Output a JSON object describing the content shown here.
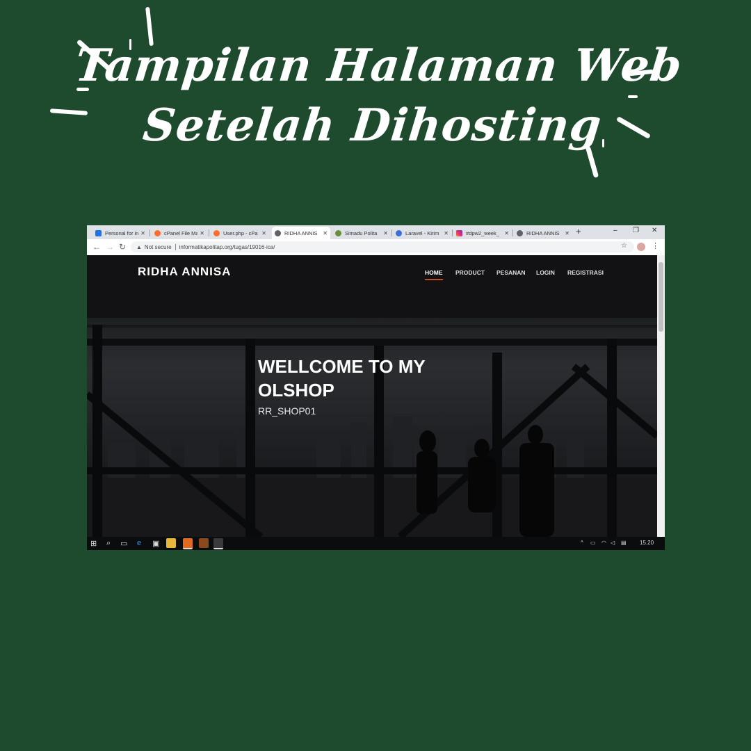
{
  "poster": {
    "title_line1": "Tampilan Halaman Web",
    "title_line2": "Setelah Dihosting"
  },
  "colors": {
    "background": "#1e4a2e",
    "accent_underline": "#c0502b"
  },
  "browser": {
    "tabs": [
      {
        "label": "Personal for in",
        "favicon": "blue-app-icon",
        "active": false
      },
      {
        "label": "cPanel File Ma",
        "favicon": "cpanel-icon",
        "active": false
      },
      {
        "label": "User.php - cPa",
        "favicon": "cpanel-icon",
        "active": false
      },
      {
        "label": "RIDHA ANNIS",
        "favicon": "globe-icon",
        "active": true
      },
      {
        "label": "Simadu Polita",
        "favicon": "green-app-icon",
        "active": false
      },
      {
        "label": "Laravel - Kirim",
        "favicon": "blue-c-icon",
        "active": false
      },
      {
        "label": "#dpw2_week_",
        "favicon": "instagram-icon",
        "active": false
      },
      {
        "label": "RIDHA ANNIS",
        "favicon": "globe-icon",
        "active": false
      }
    ],
    "new_tab": "+",
    "window_controls": {
      "minimize": "–",
      "restore": "❐",
      "close": "✕"
    },
    "address": {
      "security": "Not secure",
      "url": "informatikapolitap.org/tugas/19016-ica/"
    }
  },
  "site": {
    "brand": "RIDHA ANNISA",
    "nav": [
      "HOME",
      "PRODUCT",
      "PESANAN",
      "LOGIN",
      "REGISTRASI"
    ],
    "active_nav": "HOME",
    "hero_title": "WELLCOME TO MY OLSHOP",
    "hero_subtitle": "RR_SHOP01"
  },
  "taskbar": {
    "clock": "15.20"
  }
}
